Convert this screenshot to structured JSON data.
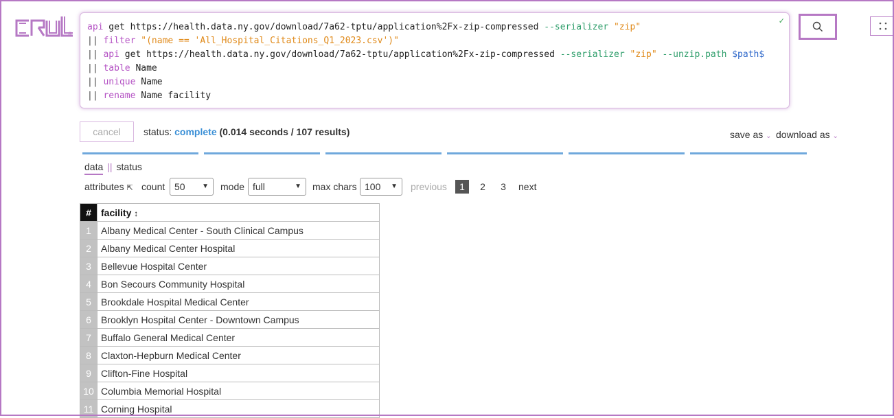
{
  "app": {
    "logo_text": "crul",
    "brand_color": "#b678c4"
  },
  "query": {
    "lines": [
      [
        {
          "t": "api",
          "c": "kw"
        },
        {
          "t": " get https://health.data.ny.gov/download/7a62-tptu/application%2Fx-zip-compressed ",
          "c": ""
        },
        {
          "t": "--serializer",
          "c": "flag"
        },
        {
          "t": " ",
          "c": ""
        },
        {
          "t": "\"zip\"",
          "c": "str"
        }
      ],
      [
        {
          "t": "|| ",
          "c": "pipe"
        },
        {
          "t": "filter",
          "c": "kw"
        },
        {
          "t": " ",
          "c": ""
        },
        {
          "t": "\"(name == 'All_Hospital_Citations_Q1_2023.csv')\"",
          "c": "str"
        }
      ],
      [
        {
          "t": "|| ",
          "c": "pipe"
        },
        {
          "t": "api",
          "c": "kw"
        },
        {
          "t": " get https://health.data.ny.gov/download/7a62-tptu/application%2Fx-zip-compressed ",
          "c": ""
        },
        {
          "t": "--serializer",
          "c": "flag"
        },
        {
          "t": " ",
          "c": ""
        },
        {
          "t": "\"zip\"",
          "c": "str"
        },
        {
          "t": " ",
          "c": ""
        },
        {
          "t": "--unzip.path",
          "c": "flag"
        },
        {
          "t": " ",
          "c": ""
        },
        {
          "t": "$path$",
          "c": "var"
        }
      ],
      [
        {
          "t": "|| ",
          "c": "pipe"
        },
        {
          "t": "table",
          "c": "kw"
        },
        {
          "t": " Name",
          "c": ""
        }
      ],
      [
        {
          "t": "|| ",
          "c": "pipe"
        },
        {
          "t": "unique",
          "c": "kw"
        },
        {
          "t": " Name",
          "c": ""
        }
      ],
      [
        {
          "t": "|| ",
          "c": "pipe"
        },
        {
          "t": "rename",
          "c": "kw"
        },
        {
          "t": " Name facility",
          "c": ""
        }
      ]
    ],
    "valid_mark": "✓"
  },
  "toolbar": {
    "cancel_label": "cancel",
    "status_label": "status:",
    "status_value": "complete",
    "status_meta": "(0.014 seconds / 107 results)",
    "save_as_label": "save as",
    "download_as_label": "download as",
    "caret": "⌄"
  },
  "subnav": {
    "data_label": "data",
    "separator": "||",
    "status_label": "status"
  },
  "controls": {
    "attributes_label": "attributes",
    "attributes_icon": "⇱",
    "count_label": "count",
    "count_value": "50",
    "mode_label": "mode",
    "mode_value": "full",
    "max_chars_label": "max chars",
    "max_chars_value": "100",
    "previous_label": "previous",
    "pages": [
      "1",
      "2",
      "3"
    ],
    "next_label": "next"
  },
  "table": {
    "index_header": "#",
    "column_header": "facility",
    "sort_icon": "↕",
    "rows": [
      {
        "n": "1",
        "v": "Albany Medical Center - South Clinical Campus"
      },
      {
        "n": "2",
        "v": "Albany Medical Center Hospital"
      },
      {
        "n": "3",
        "v": "Bellevue Hospital Center"
      },
      {
        "n": "4",
        "v": "Bon Secours Community Hospital"
      },
      {
        "n": "5",
        "v": "Brookdale Hospital Medical Center"
      },
      {
        "n": "6",
        "v": "Brooklyn Hospital Center - Downtown Campus"
      },
      {
        "n": "7",
        "v": "Buffalo General Medical Center"
      },
      {
        "n": "8",
        "v": "Claxton-Hepburn Medical Center"
      },
      {
        "n": "9",
        "v": "Clifton-Fine Hospital"
      },
      {
        "n": "10",
        "v": "Columbia Memorial Hospital"
      },
      {
        "n": "11",
        "v": "Corning Hospital"
      }
    ]
  }
}
